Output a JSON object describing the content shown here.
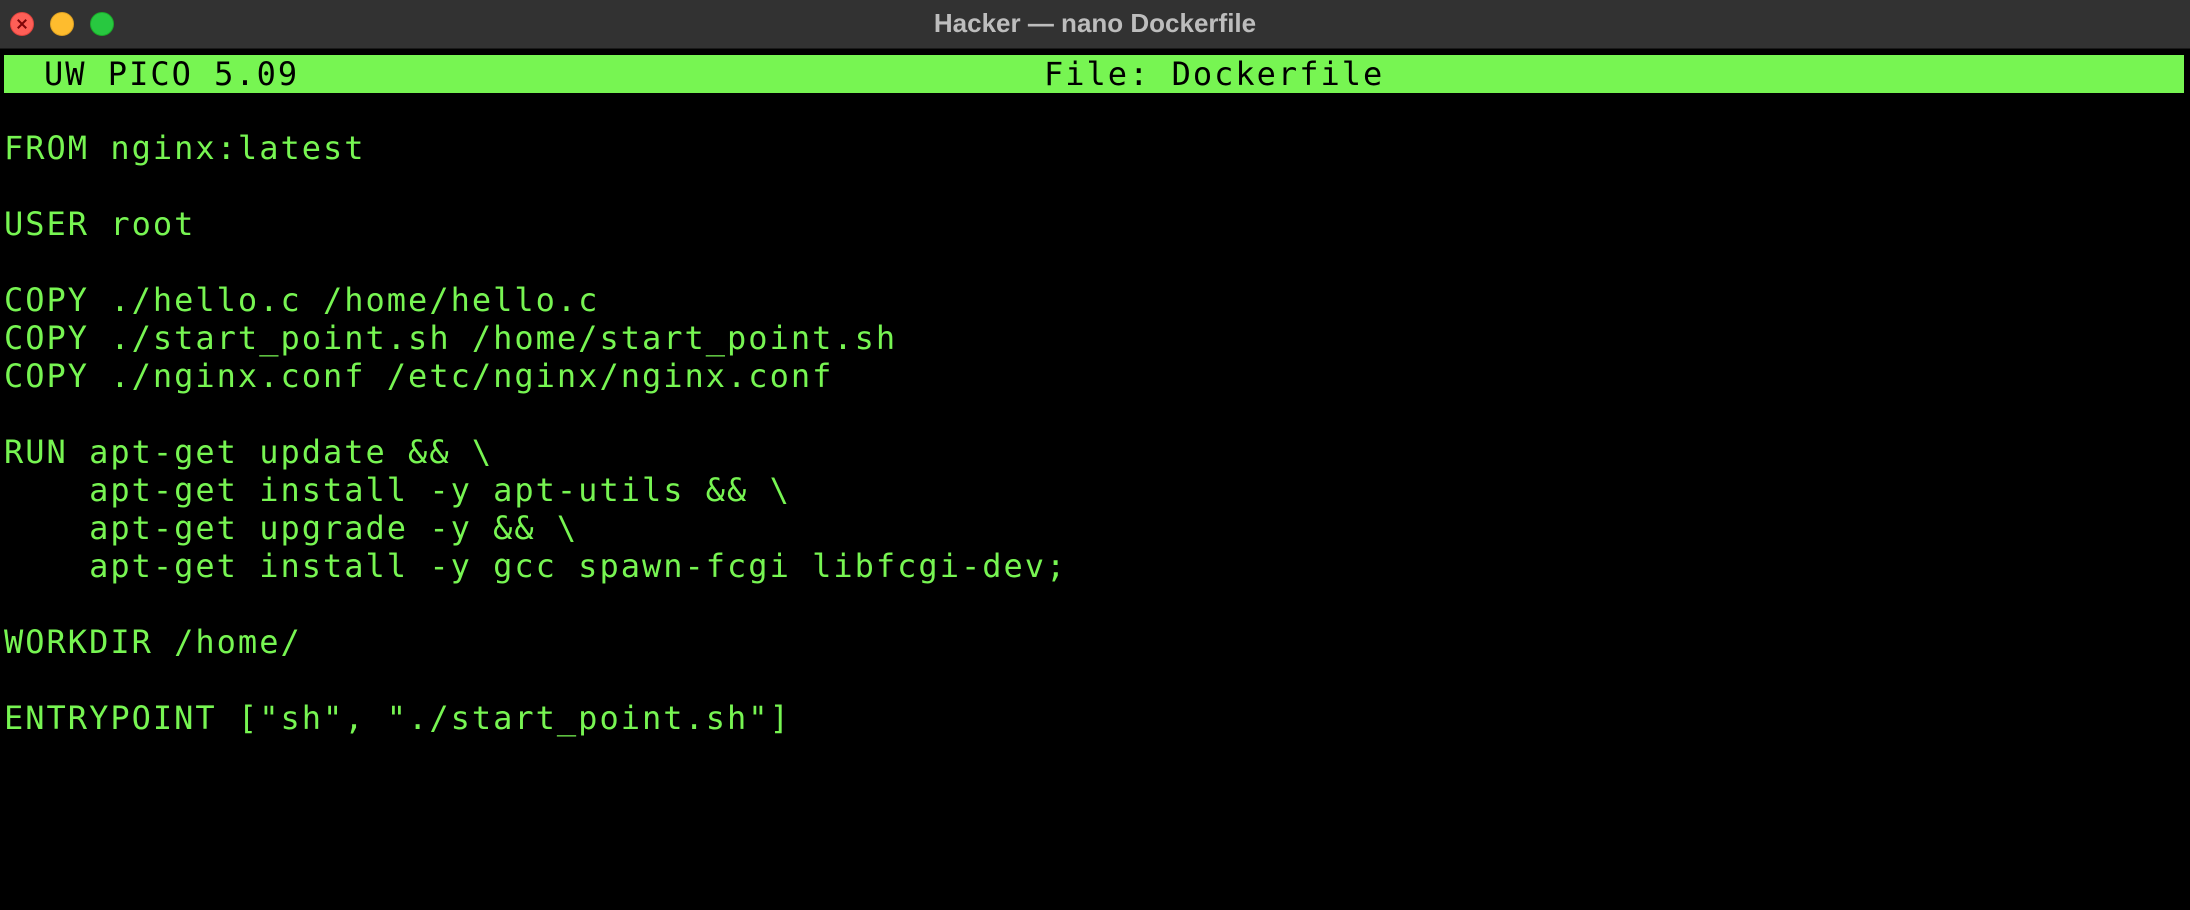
{
  "window": {
    "title": "Hacker — nano Dockerfile"
  },
  "editor_header": {
    "version": "UW PICO 5.09",
    "file": "File: Dockerfile"
  },
  "file_lines": [
    "FROM nginx:latest",
    "",
    "USER root",
    "",
    "COPY ./hello.c /home/hello.c",
    "COPY ./start_point.sh /home/start_point.sh",
    "COPY ./nginx.conf /etc/nginx/nginx.conf",
    "",
    "RUN apt-get update && \\",
    "    apt-get install -y apt-utils && \\",
    "    apt-get upgrade -y && \\",
    "    apt-get install -y gcc spawn-fcgi libfcgi-dev;",
    "",
    "WORKDIR /home/",
    "",
    "ENTRYPOINT [\"sh\", \"./start_point.sh\"]"
  ],
  "colors": {
    "terminal_text": "#77f552",
    "terminal_background": "#000000",
    "header_background": "#77f552",
    "titlebar": "#323232"
  }
}
